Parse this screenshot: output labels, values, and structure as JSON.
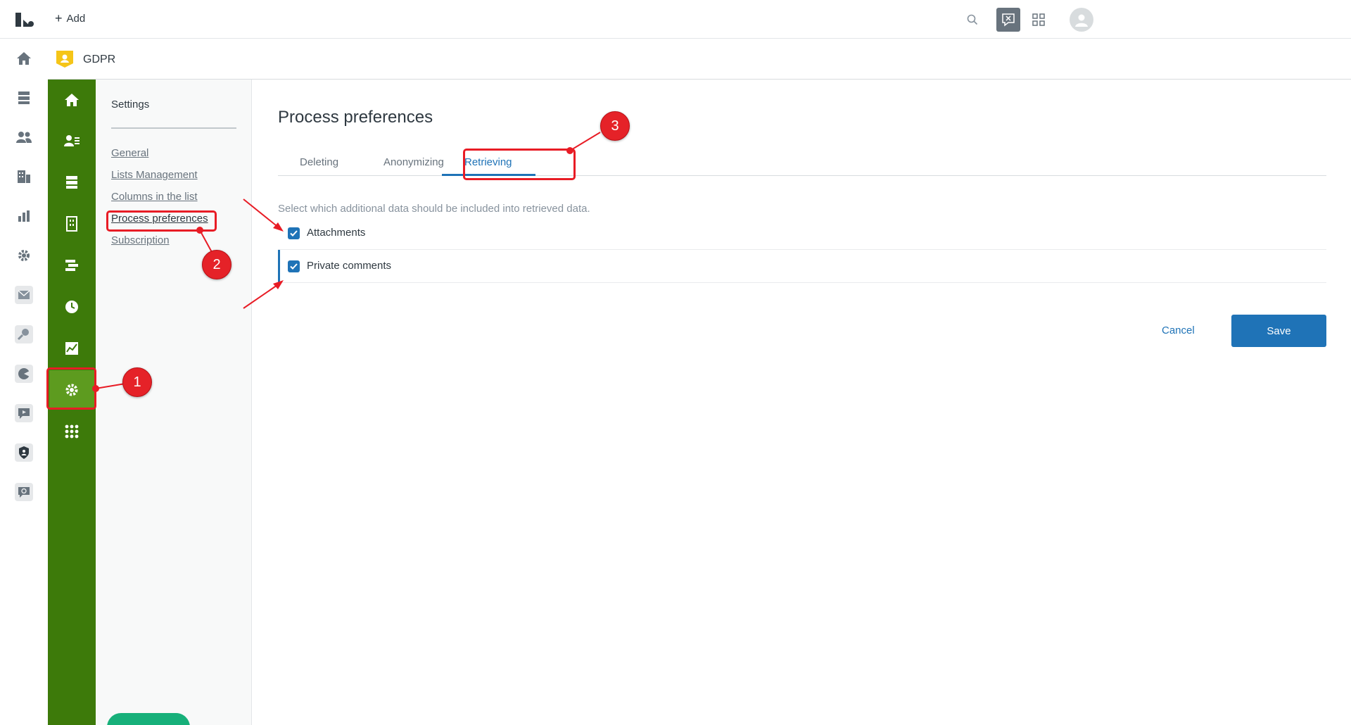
{
  "topbar": {
    "add_label": "Add"
  },
  "app": {
    "title": "GDPR"
  },
  "settings": {
    "title": "Settings",
    "links": [
      "General",
      "Lists Management",
      "Columns in the list",
      "Process preferences",
      "Subscription"
    ]
  },
  "main": {
    "title": "Process preferences",
    "tabs": [
      "Deleting",
      "Anonymizing",
      "Retrieving"
    ],
    "active_tab": "Retrieving",
    "helper": "Select which additional data should be included into retrieved data.",
    "options": [
      {
        "label": "Attachments",
        "checked": true
      },
      {
        "label": "Private comments",
        "checked": true
      }
    ],
    "cancel_label": "Cancel",
    "save_label": "Save"
  },
  "annotations": {
    "badges": [
      "1",
      "2",
      "3"
    ]
  },
  "colors": {
    "nav_green": "#3d7a0a",
    "accent_blue": "#1f73b7",
    "annotation_red": "#e81c25"
  }
}
